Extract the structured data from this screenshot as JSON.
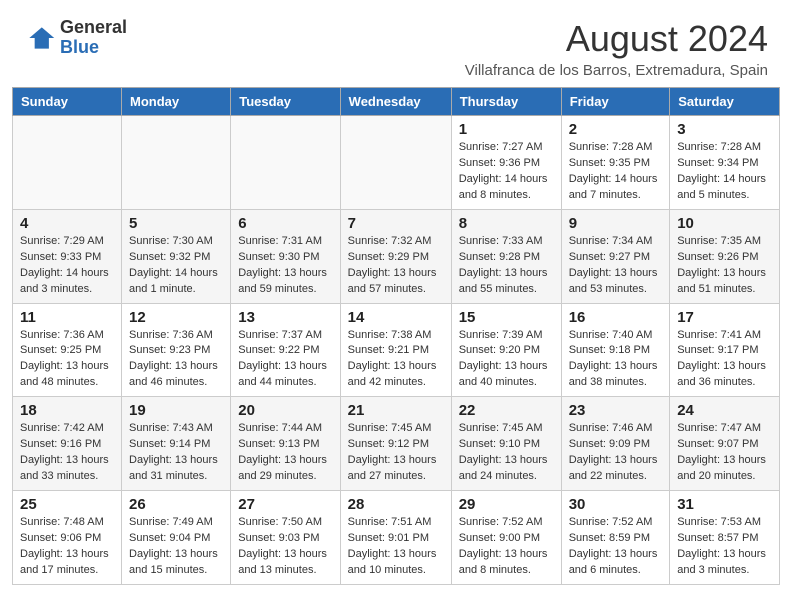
{
  "header": {
    "logo_general": "General",
    "logo_blue": "Blue",
    "month_year": "August 2024",
    "location": "Villafranca de los Barros, Extremadura, Spain"
  },
  "weekdays": [
    "Sunday",
    "Monday",
    "Tuesday",
    "Wednesday",
    "Thursday",
    "Friday",
    "Saturday"
  ],
  "weeks": [
    [
      {
        "day": "",
        "info": ""
      },
      {
        "day": "",
        "info": ""
      },
      {
        "day": "",
        "info": ""
      },
      {
        "day": "",
        "info": ""
      },
      {
        "day": "1",
        "info": "Sunrise: 7:27 AM\nSunset: 9:36 PM\nDaylight: 14 hours and 8 minutes."
      },
      {
        "day": "2",
        "info": "Sunrise: 7:28 AM\nSunset: 9:35 PM\nDaylight: 14 hours and 7 minutes."
      },
      {
        "day": "3",
        "info": "Sunrise: 7:28 AM\nSunset: 9:34 PM\nDaylight: 14 hours and 5 minutes."
      }
    ],
    [
      {
        "day": "4",
        "info": "Sunrise: 7:29 AM\nSunset: 9:33 PM\nDaylight: 14 hours and 3 minutes."
      },
      {
        "day": "5",
        "info": "Sunrise: 7:30 AM\nSunset: 9:32 PM\nDaylight: 14 hours and 1 minute."
      },
      {
        "day": "6",
        "info": "Sunrise: 7:31 AM\nSunset: 9:30 PM\nDaylight: 13 hours and 59 minutes."
      },
      {
        "day": "7",
        "info": "Sunrise: 7:32 AM\nSunset: 9:29 PM\nDaylight: 13 hours and 57 minutes."
      },
      {
        "day": "8",
        "info": "Sunrise: 7:33 AM\nSunset: 9:28 PM\nDaylight: 13 hours and 55 minutes."
      },
      {
        "day": "9",
        "info": "Sunrise: 7:34 AM\nSunset: 9:27 PM\nDaylight: 13 hours and 53 minutes."
      },
      {
        "day": "10",
        "info": "Sunrise: 7:35 AM\nSunset: 9:26 PM\nDaylight: 13 hours and 51 minutes."
      }
    ],
    [
      {
        "day": "11",
        "info": "Sunrise: 7:36 AM\nSunset: 9:25 PM\nDaylight: 13 hours and 48 minutes."
      },
      {
        "day": "12",
        "info": "Sunrise: 7:36 AM\nSunset: 9:23 PM\nDaylight: 13 hours and 46 minutes."
      },
      {
        "day": "13",
        "info": "Sunrise: 7:37 AM\nSunset: 9:22 PM\nDaylight: 13 hours and 44 minutes."
      },
      {
        "day": "14",
        "info": "Sunrise: 7:38 AM\nSunset: 9:21 PM\nDaylight: 13 hours and 42 minutes."
      },
      {
        "day": "15",
        "info": "Sunrise: 7:39 AM\nSunset: 9:20 PM\nDaylight: 13 hours and 40 minutes."
      },
      {
        "day": "16",
        "info": "Sunrise: 7:40 AM\nSunset: 9:18 PM\nDaylight: 13 hours and 38 minutes."
      },
      {
        "day": "17",
        "info": "Sunrise: 7:41 AM\nSunset: 9:17 PM\nDaylight: 13 hours and 36 minutes."
      }
    ],
    [
      {
        "day": "18",
        "info": "Sunrise: 7:42 AM\nSunset: 9:16 PM\nDaylight: 13 hours and 33 minutes."
      },
      {
        "day": "19",
        "info": "Sunrise: 7:43 AM\nSunset: 9:14 PM\nDaylight: 13 hours and 31 minutes."
      },
      {
        "day": "20",
        "info": "Sunrise: 7:44 AM\nSunset: 9:13 PM\nDaylight: 13 hours and 29 minutes."
      },
      {
        "day": "21",
        "info": "Sunrise: 7:45 AM\nSunset: 9:12 PM\nDaylight: 13 hours and 27 minutes."
      },
      {
        "day": "22",
        "info": "Sunrise: 7:45 AM\nSunset: 9:10 PM\nDaylight: 13 hours and 24 minutes."
      },
      {
        "day": "23",
        "info": "Sunrise: 7:46 AM\nSunset: 9:09 PM\nDaylight: 13 hours and 22 minutes."
      },
      {
        "day": "24",
        "info": "Sunrise: 7:47 AM\nSunset: 9:07 PM\nDaylight: 13 hours and 20 minutes."
      }
    ],
    [
      {
        "day": "25",
        "info": "Sunrise: 7:48 AM\nSunset: 9:06 PM\nDaylight: 13 hours and 17 minutes."
      },
      {
        "day": "26",
        "info": "Sunrise: 7:49 AM\nSunset: 9:04 PM\nDaylight: 13 hours and 15 minutes."
      },
      {
        "day": "27",
        "info": "Sunrise: 7:50 AM\nSunset: 9:03 PM\nDaylight: 13 hours and 13 minutes."
      },
      {
        "day": "28",
        "info": "Sunrise: 7:51 AM\nSunset: 9:01 PM\nDaylight: 13 hours and 10 minutes."
      },
      {
        "day": "29",
        "info": "Sunrise: 7:52 AM\nSunset: 9:00 PM\nDaylight: 13 hours and 8 minutes."
      },
      {
        "day": "30",
        "info": "Sunrise: 7:52 AM\nSunset: 8:59 PM\nDaylight: 13 hours and 6 minutes."
      },
      {
        "day": "31",
        "info": "Sunrise: 7:53 AM\nSunset: 8:57 PM\nDaylight: 13 hours and 3 minutes."
      }
    ]
  ]
}
